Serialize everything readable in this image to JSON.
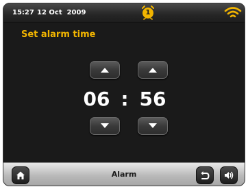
{
  "status_bar": {
    "time": "15:27",
    "date": "12 Oct  2009",
    "alarm_number": "1",
    "alarm_color": "#f2b500",
    "wifi_color": "#f2b500"
  },
  "screen": {
    "title": "Set alarm time",
    "title_color": "#f2b500"
  },
  "time_setter": {
    "hours": "06",
    "separator": ":",
    "minutes": "56",
    "up_icon": "triangle-up-icon",
    "down_icon": "triangle-down-icon"
  },
  "bottom_bar": {
    "title": "Alarm",
    "home_icon": "home-icon",
    "back_icon": "back-icon",
    "volume_icon": "volume-icon"
  }
}
